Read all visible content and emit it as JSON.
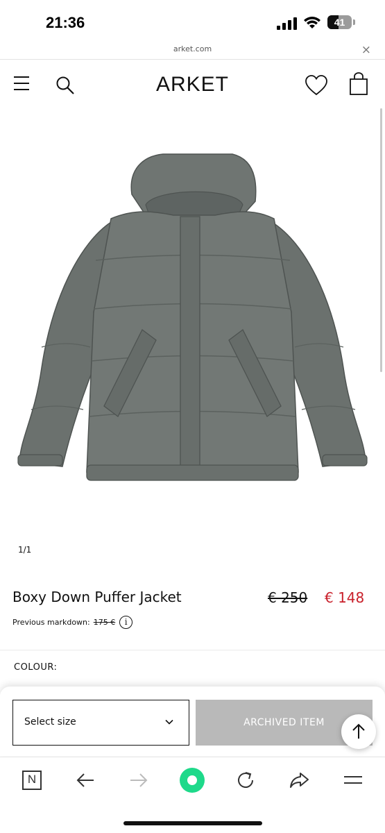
{
  "status_bar": {
    "time": "21:36",
    "battery": "41"
  },
  "url_bar": {
    "domain": "arket.com",
    "close": "×"
  },
  "header": {
    "logo": "ARKET"
  },
  "gallery": {
    "counter": "1/1"
  },
  "product": {
    "title": "Boxy Down Puffer Jacket",
    "old_price": "€ 250",
    "sale_price": "€ 148",
    "markdown_label": "Previous markdown:",
    "markdown_price": "175 €",
    "info": "i",
    "colour_label": "COLOUR:"
  },
  "purchase": {
    "size_placeholder": "Select size",
    "archived_label": "ARCHIVED ITEM"
  },
  "toolbar": {
    "n_label": "N"
  },
  "colors": {
    "sale": "#c9202b",
    "archived_bg": "#b9b9b9",
    "accent_green": "#1ed98a",
    "jacket": "#6d7370"
  }
}
